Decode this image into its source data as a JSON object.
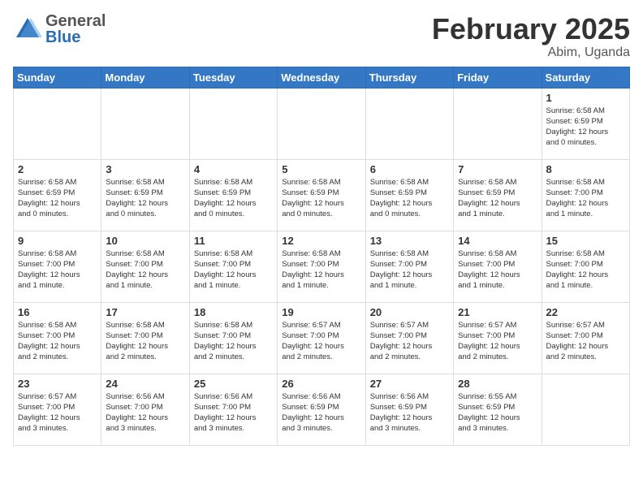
{
  "header": {
    "logo_general": "General",
    "logo_blue": "Blue",
    "month_title": "February 2025",
    "location": "Abim, Uganda"
  },
  "weekdays": [
    "Sunday",
    "Monday",
    "Tuesday",
    "Wednesday",
    "Thursday",
    "Friday",
    "Saturday"
  ],
  "weeks": [
    [
      {
        "day": "",
        "info": ""
      },
      {
        "day": "",
        "info": ""
      },
      {
        "day": "",
        "info": ""
      },
      {
        "day": "",
        "info": ""
      },
      {
        "day": "",
        "info": ""
      },
      {
        "day": "",
        "info": ""
      },
      {
        "day": "1",
        "info": "Sunrise: 6:58 AM\nSunset: 6:59 PM\nDaylight: 12 hours\nand 0 minutes."
      }
    ],
    [
      {
        "day": "2",
        "info": "Sunrise: 6:58 AM\nSunset: 6:59 PM\nDaylight: 12 hours\nand 0 minutes."
      },
      {
        "day": "3",
        "info": "Sunrise: 6:58 AM\nSunset: 6:59 PM\nDaylight: 12 hours\nand 0 minutes."
      },
      {
        "day": "4",
        "info": "Sunrise: 6:58 AM\nSunset: 6:59 PM\nDaylight: 12 hours\nand 0 minutes."
      },
      {
        "day": "5",
        "info": "Sunrise: 6:58 AM\nSunset: 6:59 PM\nDaylight: 12 hours\nand 0 minutes."
      },
      {
        "day": "6",
        "info": "Sunrise: 6:58 AM\nSunset: 6:59 PM\nDaylight: 12 hours\nand 0 minutes."
      },
      {
        "day": "7",
        "info": "Sunrise: 6:58 AM\nSunset: 6:59 PM\nDaylight: 12 hours\nand 1 minute."
      },
      {
        "day": "8",
        "info": "Sunrise: 6:58 AM\nSunset: 7:00 PM\nDaylight: 12 hours\nand 1 minute."
      }
    ],
    [
      {
        "day": "9",
        "info": "Sunrise: 6:58 AM\nSunset: 7:00 PM\nDaylight: 12 hours\nand 1 minute."
      },
      {
        "day": "10",
        "info": "Sunrise: 6:58 AM\nSunset: 7:00 PM\nDaylight: 12 hours\nand 1 minute."
      },
      {
        "day": "11",
        "info": "Sunrise: 6:58 AM\nSunset: 7:00 PM\nDaylight: 12 hours\nand 1 minute."
      },
      {
        "day": "12",
        "info": "Sunrise: 6:58 AM\nSunset: 7:00 PM\nDaylight: 12 hours\nand 1 minute."
      },
      {
        "day": "13",
        "info": "Sunrise: 6:58 AM\nSunset: 7:00 PM\nDaylight: 12 hours\nand 1 minute."
      },
      {
        "day": "14",
        "info": "Sunrise: 6:58 AM\nSunset: 7:00 PM\nDaylight: 12 hours\nand 1 minute."
      },
      {
        "day": "15",
        "info": "Sunrise: 6:58 AM\nSunset: 7:00 PM\nDaylight: 12 hours\nand 1 minute."
      }
    ],
    [
      {
        "day": "16",
        "info": "Sunrise: 6:58 AM\nSunset: 7:00 PM\nDaylight: 12 hours\nand 2 minutes."
      },
      {
        "day": "17",
        "info": "Sunrise: 6:58 AM\nSunset: 7:00 PM\nDaylight: 12 hours\nand 2 minutes."
      },
      {
        "day": "18",
        "info": "Sunrise: 6:58 AM\nSunset: 7:00 PM\nDaylight: 12 hours\nand 2 minutes."
      },
      {
        "day": "19",
        "info": "Sunrise: 6:57 AM\nSunset: 7:00 PM\nDaylight: 12 hours\nand 2 minutes."
      },
      {
        "day": "20",
        "info": "Sunrise: 6:57 AM\nSunset: 7:00 PM\nDaylight: 12 hours\nand 2 minutes."
      },
      {
        "day": "21",
        "info": "Sunrise: 6:57 AM\nSunset: 7:00 PM\nDaylight: 12 hours\nand 2 minutes."
      },
      {
        "day": "22",
        "info": "Sunrise: 6:57 AM\nSunset: 7:00 PM\nDaylight: 12 hours\nand 2 minutes."
      }
    ],
    [
      {
        "day": "23",
        "info": "Sunrise: 6:57 AM\nSunset: 7:00 PM\nDaylight: 12 hours\nand 3 minutes."
      },
      {
        "day": "24",
        "info": "Sunrise: 6:56 AM\nSunset: 7:00 PM\nDaylight: 12 hours\nand 3 minutes."
      },
      {
        "day": "25",
        "info": "Sunrise: 6:56 AM\nSunset: 7:00 PM\nDaylight: 12 hours\nand 3 minutes."
      },
      {
        "day": "26",
        "info": "Sunrise: 6:56 AM\nSunset: 6:59 PM\nDaylight: 12 hours\nand 3 minutes."
      },
      {
        "day": "27",
        "info": "Sunrise: 6:56 AM\nSunset: 6:59 PM\nDaylight: 12 hours\nand 3 minutes."
      },
      {
        "day": "28",
        "info": "Sunrise: 6:55 AM\nSunset: 6:59 PM\nDaylight: 12 hours\nand 3 minutes."
      },
      {
        "day": "",
        "info": ""
      }
    ]
  ]
}
